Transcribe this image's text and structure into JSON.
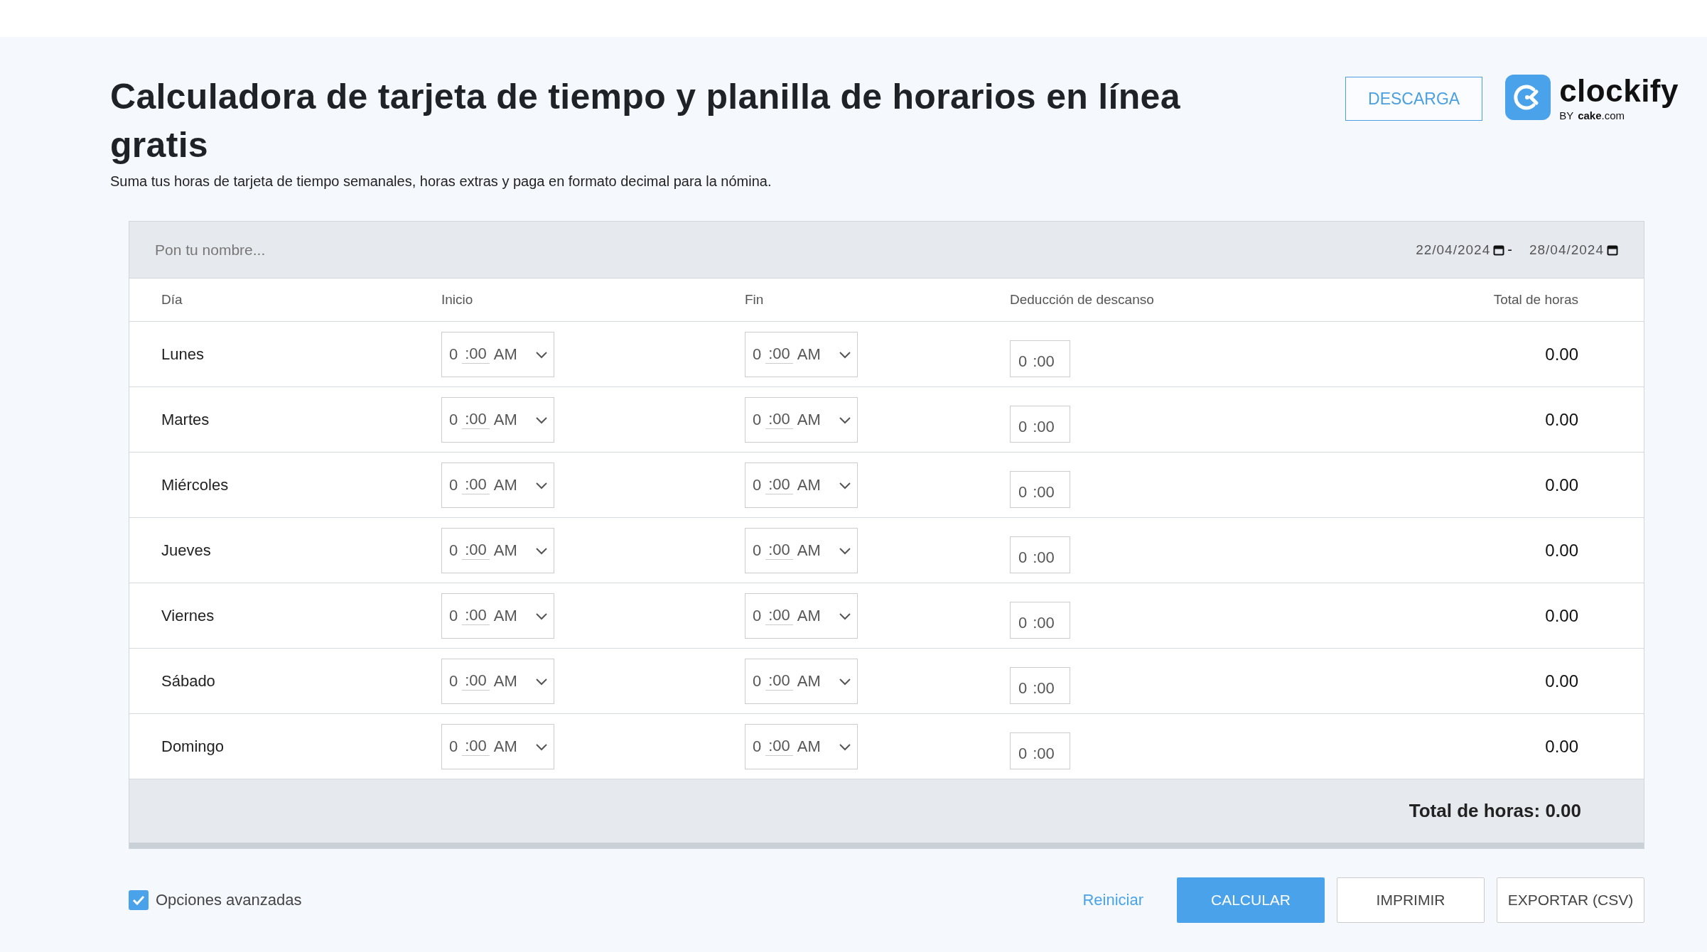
{
  "header": {
    "title": "Calculadora de tarjeta de tiempo y planilla de horarios en línea gratis",
    "subtitle": "Suma tus horas de tarjeta de tiempo semanales, horas extras y paga en formato decimal para la nómina.",
    "download_button": "DESCARGA",
    "logo": {
      "name": "clockify",
      "by": "BY",
      "company": "**cake**.com"
    }
  },
  "timesheet": {
    "name_placeholder": "Pon tu nombre...",
    "date_from": "22/04/2024",
    "date_separator": "-",
    "date_to": "28/04/2024",
    "columns": [
      "Día",
      "Inicio",
      "Fin",
      "Deducción de descanso",
      "Total de horas"
    ],
    "rows": [
      {
        "day": "Lunes",
        "start": {
          "hour": "0",
          "minutes": ":00",
          "period": "AM"
        },
        "end": {
          "hour": "0",
          "minutes": ":00",
          "period": "AM"
        },
        "break": {
          "hour": "0",
          "minutes": ":00"
        },
        "total": "0.00"
      },
      {
        "day": "Martes",
        "start": {
          "hour": "0",
          "minutes": ":00",
          "period": "AM"
        },
        "end": {
          "hour": "0",
          "minutes": ":00",
          "period": "AM"
        },
        "break": {
          "hour": "0",
          "minutes": ":00"
        },
        "total": "0.00"
      },
      {
        "day": "Miércoles",
        "start": {
          "hour": "0",
          "minutes": ":00",
          "period": "AM"
        },
        "end": {
          "hour": "0",
          "minutes": ":00",
          "period": "AM"
        },
        "break": {
          "hour": "0",
          "minutes": ":00"
        },
        "total": "0.00"
      },
      {
        "day": "Jueves",
        "start": {
          "hour": "0",
          "minutes": ":00",
          "period": "AM"
        },
        "end": {
          "hour": "0",
          "minutes": ":00",
          "period": "AM"
        },
        "break": {
          "hour": "0",
          "minutes": ":00"
        },
        "total": "0.00"
      },
      {
        "day": "Viernes",
        "start": {
          "hour": "0",
          "minutes": ":00",
          "period": "AM"
        },
        "end": {
          "hour": "0",
          "minutes": ":00",
          "period": "AM"
        },
        "break": {
          "hour": "0",
          "minutes": ":00"
        },
        "total": "0.00"
      },
      {
        "day": "Sábado",
        "start": {
          "hour": "0",
          "minutes": ":00",
          "period": "AM"
        },
        "end": {
          "hour": "0",
          "minutes": ":00",
          "period": "AM"
        },
        "break": {
          "hour": "0",
          "minutes": ":00"
        },
        "total": "0.00"
      },
      {
        "day": "Domingo",
        "start": {
          "hour": "0",
          "minutes": ":00",
          "period": "AM"
        },
        "end": {
          "hour": "0",
          "minutes": ":00",
          "period": "AM"
        },
        "break": {
          "hour": "0",
          "minutes": ":00"
        },
        "total": "0.00"
      }
    ],
    "grand_total": "Total de horas: 0.00"
  },
  "actions": {
    "advanced_options": {
      "label": "Opciones avanzadas",
      "checked": true
    },
    "reset_link": "Reiniciar",
    "buttons": [
      {
        "label": "CALCULAR",
        "kind": "primary"
      },
      {
        "label": "IMPRIMIR",
        "kind": "outline"
      },
      {
        "label": "EXPORTAR (CSV)",
        "kind": "outline"
      }
    ]
  }
}
